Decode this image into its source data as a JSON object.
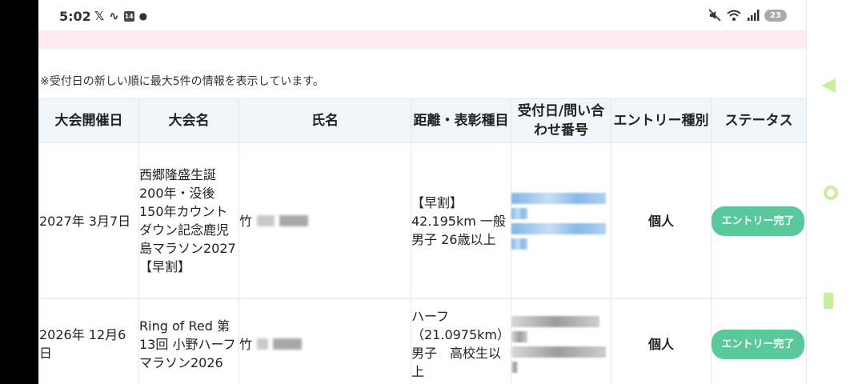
{
  "status_bar": {
    "time": "5:02",
    "notification_badge": "14",
    "battery": "23"
  },
  "notice": "※受付日の新しい順に最大5件の情報を表示しています。",
  "table": {
    "headers": [
      "大会開催日",
      "大会名",
      "氏名",
      "距離・表彰種目",
      "受付日/問い合わせ番号",
      "エントリー種別",
      "ステータス"
    ],
    "rows": [
      {
        "date": "2027年 3月7日",
        "event": "西郷隆盛生誕200年・没後150年カウントダウン記念鹿児島マラソン2027【早割】",
        "name_prefix": "竹",
        "distance": "【早割】42.195km 一般男子 26歳以上",
        "entry_type": "個人",
        "status": "エントリー完了"
      },
      {
        "date": "2026年 12月6日",
        "event": "Ring of Red 第13回 小野ハーフマラソン2026",
        "name_prefix": "竹",
        "distance": "ハーフ（21.0975km）男子　高校生以上",
        "entry_type": "個人",
        "status": "エントリー完了"
      }
    ]
  },
  "colors": {
    "header_bg": "#f1f6fb",
    "pink_band": "#fdebf0",
    "status_green": "#59c99c",
    "side_icons": "#c8ef9c"
  },
  "icons": [
    "x-icon",
    "activity-icon",
    "notification-badge-icon",
    "mute-icon",
    "wifi-icon",
    "signal-icon",
    "battery-icon",
    "back-triangle-icon",
    "home-circle-icon",
    "recent-apps-icon"
  ]
}
